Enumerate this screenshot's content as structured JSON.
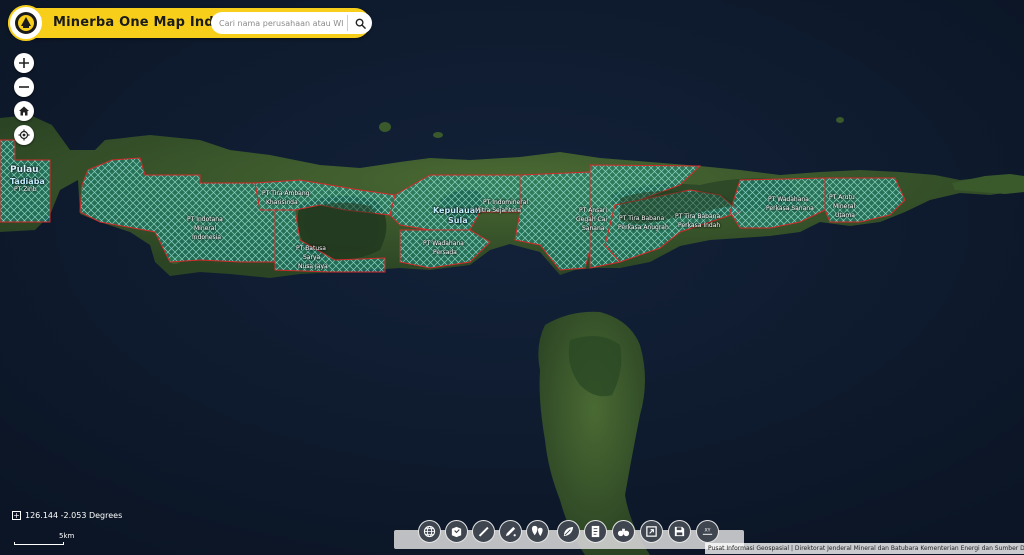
{
  "header": {
    "title": "Minerba One Map Indonesia",
    "search_placeholder": "Cari nama perusahaan atau WIUP ID",
    "logo_icon": "emblem-icon",
    "search_icon": "search-icon"
  },
  "colors": {
    "header": "#f7cf1a",
    "sea": "#0e1a2b",
    "land": "#3b5a2a",
    "concession_fill": "#1fb3a3",
    "concession_border": "#d22a2a"
  },
  "map_controls": [
    {
      "name": "zoom-in-button",
      "icon": "plus-icon"
    },
    {
      "name": "zoom-out-button",
      "icon": "minus-icon"
    },
    {
      "name": "home-button",
      "icon": "home-icon"
    },
    {
      "name": "locate-button",
      "icon": "crosshair-icon"
    }
  ],
  "map_labels": {
    "pulau_flores": "Pulau",
    "pulau_flores_2": "Tadiaba",
    "pt_west": "PT Zinb",
    "pt_indotan_1": "PT Indotana",
    "pt_indotan_2": "Mineral",
    "pt_indotan_3": "Indonesia",
    "pt_tira_1": "PT Tira Ambang",
    "pt_tira_2": "Kharisinda",
    "pt_batusa_1": "PT Batusa",
    "pt_batusa_2": "Sarya",
    "pt_batusa_3": "Nusa Jaya",
    "kep_1": "Kepulauan",
    "kep_2": "Sula",
    "pt_indomineral_1": "PT Indomineral",
    "pt_indomineral_2": "Mitra Sejahtera",
    "pt_wadah_1": "PT Wadahana",
    "pt_wadah_2": "Persada",
    "pt_ansari_1": "PT Ansari",
    "pt_ansari_2": "Gegah Cai",
    "pt_ansari_3": "Sanana",
    "pt_tira2_1": "PT Tira Babana",
    "pt_tira2_2": "Perkasa Anugrah",
    "pt_tira3_1": "PT Tira Babana",
    "pt_tira3_2": "Perkasa Indah",
    "pt_wadah2_1": "PT Wadahana",
    "pt_wadah2_2": "Perkasa Sanana",
    "pt_arutu_1": "PT Arutu",
    "pt_arutu_2": "Mineral",
    "pt_arutu_3": "Utama"
  },
  "status": {
    "coordinates": "126.144 -2.053 Degrees",
    "scale_label": "5km"
  },
  "toolbar": [
    {
      "name": "basemap-tool",
      "icon": "globe-icon"
    },
    {
      "name": "layers-tool",
      "icon": "layers-icon"
    },
    {
      "name": "measure-tool",
      "icon": "ruler-icon"
    },
    {
      "name": "draw-tool",
      "icon": "pencil-icon"
    },
    {
      "name": "identify-tool",
      "icon": "map-pin-icon"
    },
    {
      "name": "query-tool",
      "icon": "leaf-icon"
    },
    {
      "name": "print-tool",
      "icon": "printer-icon"
    },
    {
      "name": "analysis-tool",
      "icon": "binoculars-icon"
    },
    {
      "name": "share-tool",
      "icon": "share-icon"
    },
    {
      "name": "save-tool",
      "icon": "save-icon"
    },
    {
      "name": "xy-tool",
      "icon": "xy-icon"
    }
  ],
  "attribution": "Pusat Informasi Geospasial | Direktorat Jenderal Mineral dan Batubara Kementerian Energi dan Sumber Daya Mineral"
}
